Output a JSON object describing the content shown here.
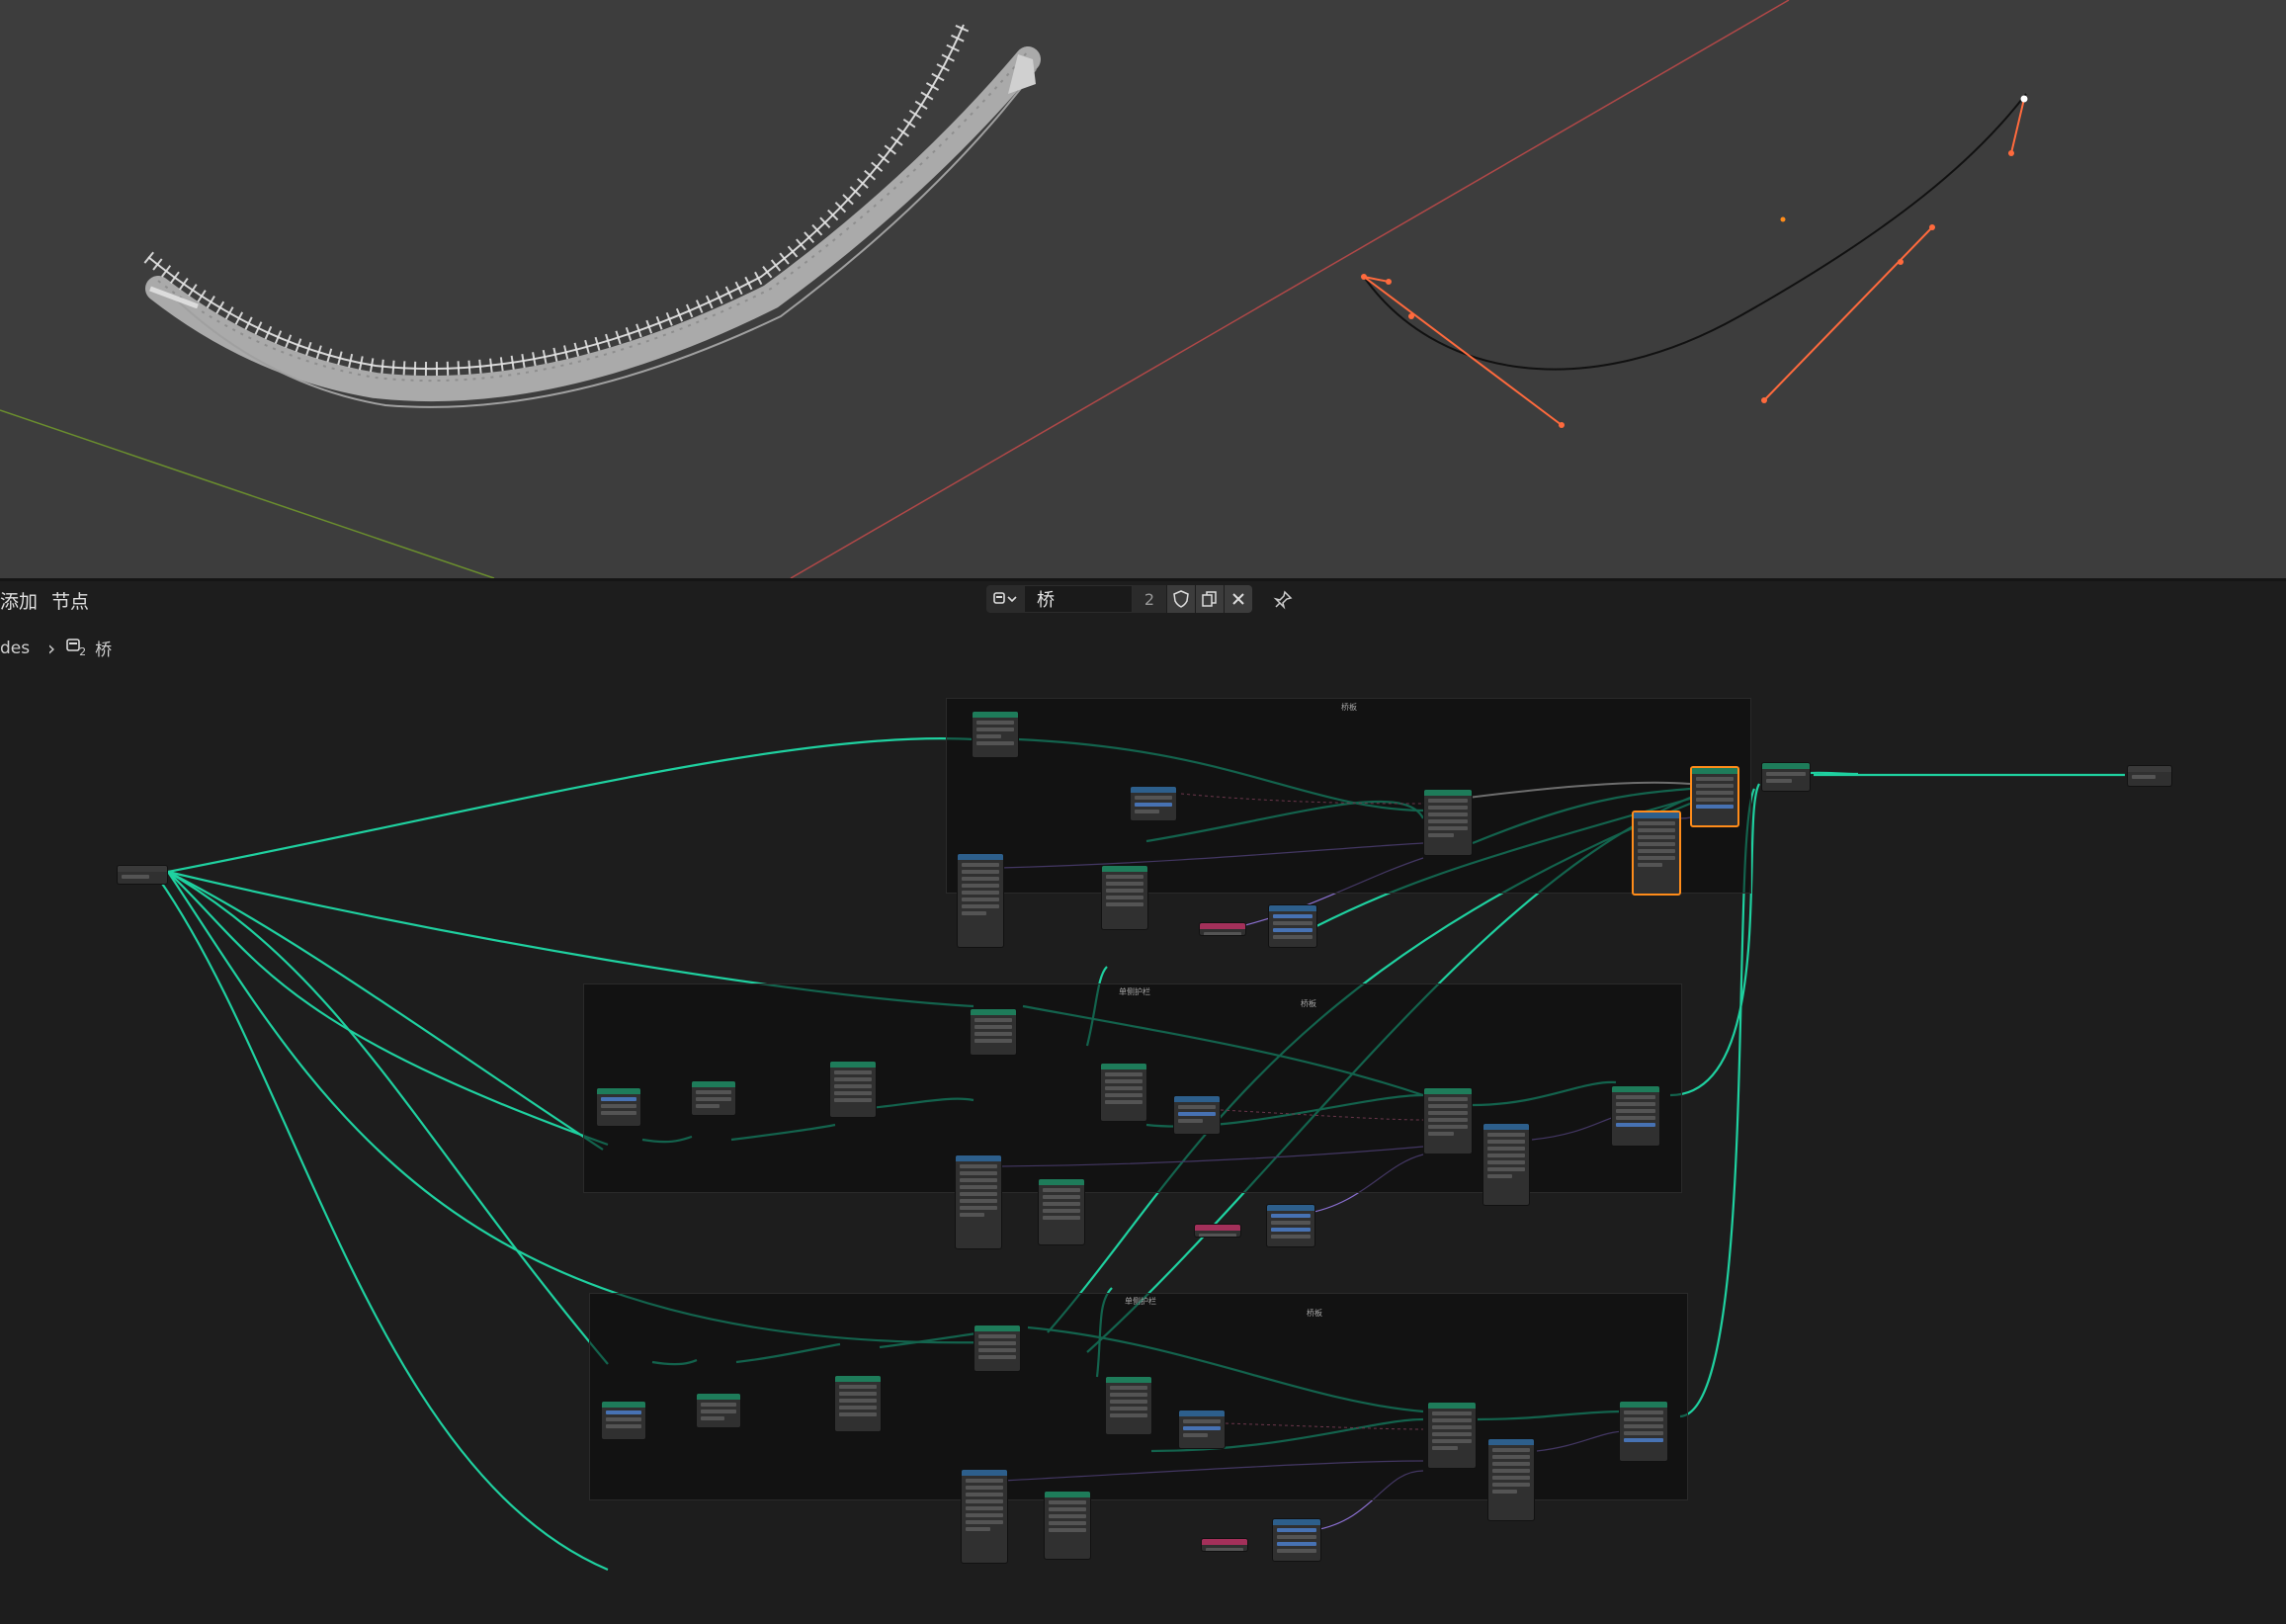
{
  "menu": {
    "add": "添加",
    "node": "节点"
  },
  "tree_selector": {
    "name": "桥",
    "users": "2"
  },
  "breadcrumb": {
    "parent": "des",
    "separator": "›",
    "tree_users": "2",
    "tree_name": "桥"
  },
  "frames": {
    "top_label": "桥板",
    "middle_label": "单侧护栏",
    "middle_sub_label": "桥板",
    "bottom_label": "单侧护栏",
    "bottom_sub_label": "桥板"
  },
  "icons": {
    "tree_type": "node-tree-icon",
    "fake_user": "shield-icon",
    "duplicate": "duplicate-icon",
    "unlink": "close-icon",
    "pin": "pin-icon"
  },
  "colors": {
    "viewport_bg": "#3d3d3d",
    "editor_bg": "#1d1d1d",
    "geometry_link": "#1fd1a0",
    "curve_handle": "#ff6a3d",
    "x_axis": "#b04848",
    "y_axis": "#6b8f2e",
    "selected_node": "#ff8c1a"
  }
}
